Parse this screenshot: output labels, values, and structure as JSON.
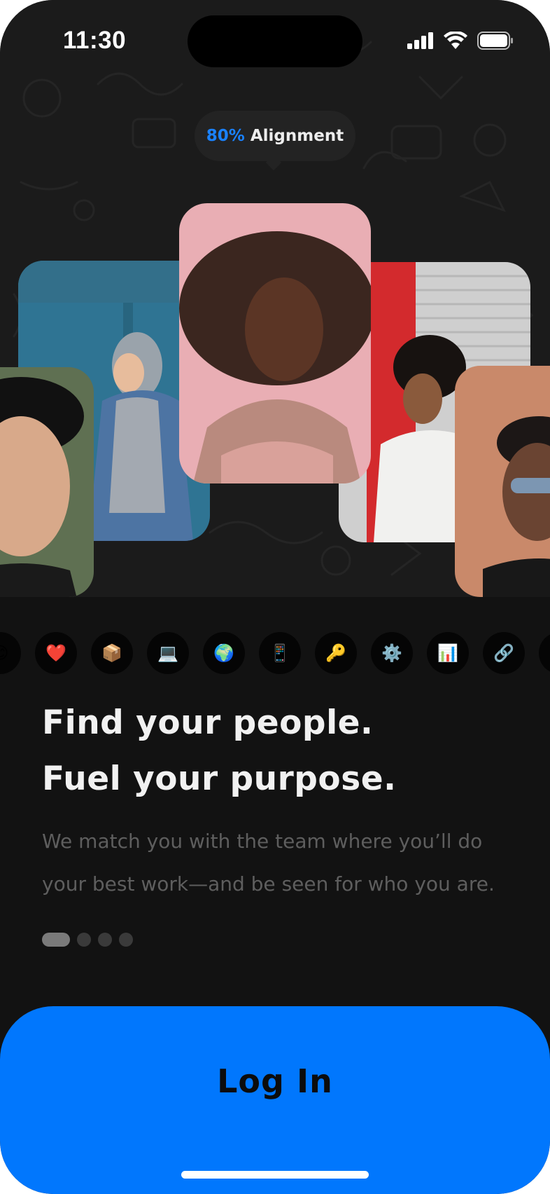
{
  "status_bar": {
    "time": "11:30",
    "icons": [
      "cellular-signal-icon",
      "wifi-icon",
      "battery-icon"
    ]
  },
  "match_badge": {
    "percent": "80%",
    "label": "Alignment",
    "accent_color": "#1a82ff"
  },
  "photos": [
    {
      "name": "profile-photo-blue-wall",
      "description_hint": "person in hoodie and denim jacket against blue wall"
    },
    {
      "name": "profile-photo-pink",
      "description_hint": "portrait on pink background"
    },
    {
      "name": "profile-photo-red-shutter",
      "description_hint": "person in white fleece by red shutter"
    },
    {
      "name": "profile-photo-green",
      "description_hint": "close-up portrait, green background"
    },
    {
      "name": "profile-photo-orange-wall",
      "description_hint": "person with sunglasses against orange wall"
    }
  ],
  "interest_icons": [
    {
      "name": "smile-emoji-icon",
      "glyph": "😊"
    },
    {
      "name": "heart-emoji-icon",
      "glyph": "❤️"
    },
    {
      "name": "package-emoji-icon",
      "glyph": "📦"
    },
    {
      "name": "laptop-emoji-icon",
      "glyph": "💻"
    },
    {
      "name": "globe-emoji-icon",
      "glyph": "🌍"
    },
    {
      "name": "phone-emoji-icon",
      "glyph": "📱"
    },
    {
      "name": "key-emoji-icon",
      "glyph": "🔑"
    },
    {
      "name": "gear-emoji-icon",
      "glyph": "⚙️"
    },
    {
      "name": "bar-chart-emoji-icon",
      "glyph": "📊"
    },
    {
      "name": "link-emoji-icon",
      "glyph": "🔗"
    },
    {
      "name": "search-emoji-icon",
      "glyph": "🔍"
    }
  ],
  "headline": {
    "line1": "Find your people.",
    "line2": "Fuel your purpose."
  },
  "description": {
    "line1": "We match you with the team where you’ll do",
    "line2": "your best work—and be seen for who you are."
  },
  "pagination": {
    "total": 4,
    "active_index": 0
  },
  "login_button": {
    "label": "Log In",
    "color": "#0177fd"
  }
}
